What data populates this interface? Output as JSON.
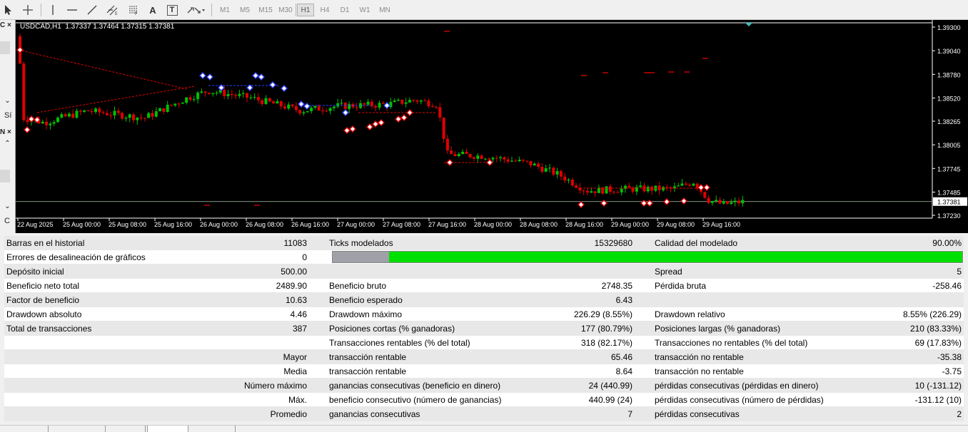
{
  "toolbar": {
    "tools": [
      {
        "name": "cursor-arrow-icon"
      },
      {
        "name": "crosshair-icon"
      },
      {
        "name": "vertical-line-icon"
      },
      {
        "name": "horizontal-line-icon"
      },
      {
        "name": "trend-line-icon"
      },
      {
        "name": "equidistant-channel-icon"
      },
      {
        "name": "fibonacci-icon"
      },
      {
        "name": "text-icon",
        "label": "A"
      },
      {
        "name": "text-label-icon",
        "label": "T"
      },
      {
        "name": "arrows-shapes-icon"
      }
    ],
    "timeframes": [
      "M1",
      "M5",
      "M15",
      "M30",
      "H1",
      "H4",
      "D1",
      "W1",
      "MN"
    ],
    "active_timeframe": "H1"
  },
  "left_panel": {
    "items": [
      "C ×",
      "Sí",
      "N ×",
      "C"
    ]
  },
  "chart": {
    "symbol_header": "USDCAD,H1  1.37337 1.37464 1.37315 1.37381",
    "current_price": "1.37381",
    "price_ticks": [
      "1.39300",
      "1.39040",
      "1.38780",
      "1.38520",
      "1.38265",
      "1.38005",
      "1.37745",
      "1.37485",
      "1.37230"
    ],
    "time_labels": [
      "22 Aug 2025",
      "25 Aug 00:00",
      "25 Aug 08:00",
      "25 Aug 16:00",
      "26 Aug 00:00",
      "26 Aug 08:00",
      "26 Aug 16:00",
      "27 Aug 00:00",
      "27 Aug 08:00",
      "27 Aug 16:00",
      "28 Aug 00:00",
      "28 Aug 08:00",
      "28 Aug 16:00",
      "29 Aug 00:00",
      "29 Aug 08:00",
      "29 Aug 16:00"
    ],
    "colors": {
      "bull": "#00c000",
      "bear": "#e00000",
      "background": "#000000",
      "text": "#ffffff",
      "price_line": "#b0c8b0"
    }
  },
  "report": {
    "rows": [
      {
        "c1": "Barras en el historial",
        "v1": "11083",
        "c2": "Ticks modelados",
        "v2": "15329680",
        "c3": "Calidad del modelado",
        "v3": "90.00%"
      },
      {
        "c1": "Errores de desalineación de gráficos",
        "v1": "0"
      },
      {
        "c1": "Depósito inicial",
        "v1": "500.00",
        "c3": "Spread",
        "v3": "5"
      },
      {
        "c1": "Beneficio neto total",
        "v1": "2489.90",
        "c2": "Beneficio bruto",
        "v2": "2748.35",
        "c3": "Pérdida bruta",
        "v3": "-258.46"
      },
      {
        "c1": "Factor de beneficio",
        "v1": "10.63",
        "c2": "Beneficio esperado",
        "v2": "6.43"
      },
      {
        "c1": "Drawdown absoluto",
        "v1": "4.46",
        "c2": "Drawdown máximo",
        "v2": "226.29 (8.55%)",
        "c3": "Drawdown relativo",
        "v3": "8.55% (226.29)"
      },
      {
        "c1": "Total de transacciones",
        "v1": "387",
        "c2": "Posiciones cortas (% ganadoras)",
        "v2": "177 (80.79%)",
        "c3": "Posiciones largas (% ganadoras)",
        "v3": "210 (83.33%)"
      },
      {
        "c2": "Transacciones rentables (% del total)",
        "v2": "318 (82.17%)",
        "c3": "Transacciones no rentables (% del total)",
        "v3": "69 (17.83%)"
      },
      {
        "v1": "Mayor",
        "c2": "transacción rentable",
        "v2": "65.46",
        "c3": "transacción no rentable",
        "v3": "-35.38"
      },
      {
        "v1": "Media",
        "c2": "transacción rentable",
        "v2": "8.64",
        "c3": "transacción no rentable",
        "v3": "-3.75"
      },
      {
        "v1": "Número máximo",
        "c2": "ganancias consecutivas (beneficio en dinero)",
        "v2": "24 (440.99)",
        "c3": "pérdidas consecutivas (pérdidas en dinero)",
        "v3": "10 (-131.12)"
      },
      {
        "v1": "Máx.",
        "c2": "beneficio consecutivo (número de ganancias)",
        "v2": "440.99 (24)",
        "c3": "pérdidas consecutivas (número de pérdidas)",
        "v3": "-131.12 (10)"
      },
      {
        "v1": "Promedio",
        "c2": "ganancias consecutivas",
        "v2": "7",
        "c3": "pérdidas consecutivas",
        "v3": "2"
      }
    ],
    "modeling_progress_gray_fraction": 0.09,
    "colors": {
      "progress_fill": "#00e000",
      "progress_gray": "#a0a0a8"
    }
  }
}
